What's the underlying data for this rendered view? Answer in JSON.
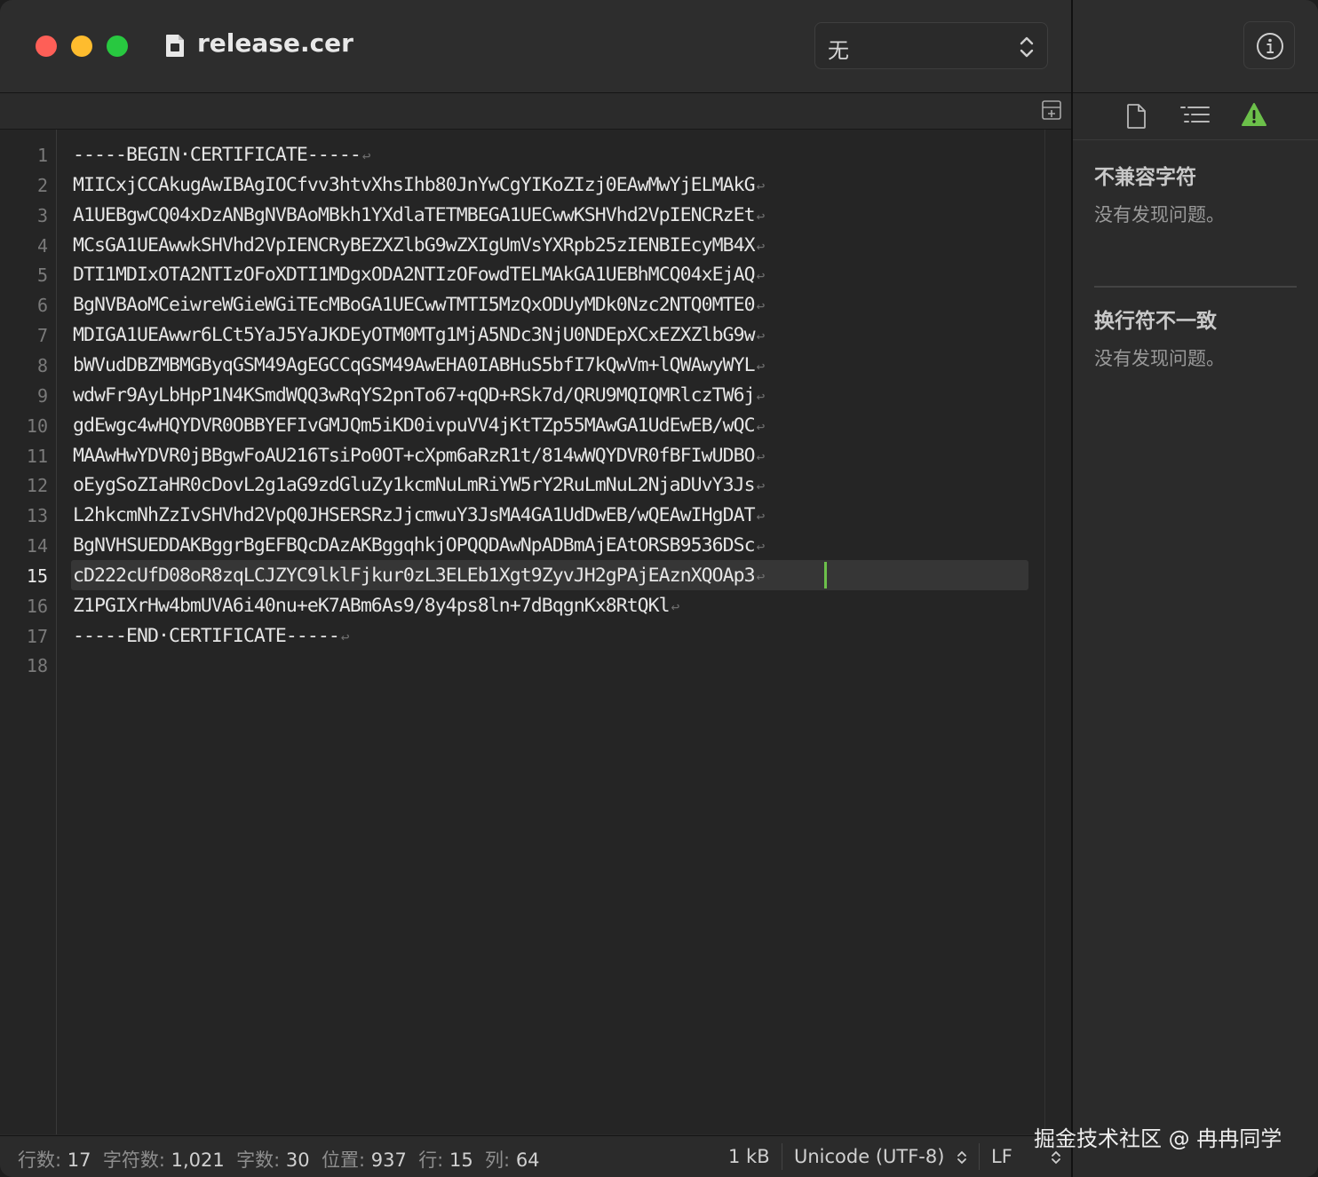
{
  "window": {
    "title": "release.cer",
    "syntax_selector": {
      "value": "无"
    }
  },
  "editor": {
    "current_line": 15,
    "lines": [
      {
        "num": "1",
        "text": "-----BEGIN·CERTIFICATE-----"
      },
      {
        "num": "2",
        "text": "MIICxjCCAkugAwIBAgIOCfvv3htvXhsIhb80JnYwCgYIKoZIzj0EAwMwYjELMAkG"
      },
      {
        "num": "3",
        "text": "A1UEBgwCQ04xDzANBgNVBAoMBkh1YXdlaTETMBEGA1UECwwKSHVhd2VpIENCRzEt"
      },
      {
        "num": "4",
        "text": "MCsGA1UEAwwkSHVhd2VpIENCRyBEZXZlbG9wZXIgUmVsYXRpb25zIENBIEcyMB4X"
      },
      {
        "num": "5",
        "text": "DTI1MDIxOTA2NTIzOFoXDTI1MDgxODA2NTIzOFowdTELMAkGA1UEBhMCQ04xEjAQ"
      },
      {
        "num": "6",
        "text": "BgNVBAoMCeiwreWGieWGiTEcMBoGA1UECwwTMTI5MzQxODUyMDk0Nzc2NTQ0MTE0"
      },
      {
        "num": "7",
        "text": "MDIGA1UEAwwr6LCt5YaJ5YaJKDEyOTM0MTg1MjA5NDc3NjU0NDEpXCxEZXZlbG9w"
      },
      {
        "num": "8",
        "text": "bWVudDBZMBMGByqGSM49AgEGCCqGSM49AwEHA0IABHuS5bfI7kQwVm+lQWAwyWYL"
      },
      {
        "num": "9",
        "text": "wdwFr9AyLbHpP1N4KSmdWQQ3wRqYS2pnTo67+qQD+RSk7d/QRU9MQIQMRlczTW6j"
      },
      {
        "num": "10",
        "text": "gdEwgc4wHQYDVR0OBBYEFIvGMJQm5iKD0ivpuVV4jKtTZp55MAwGA1UdEwEB/wQC"
      },
      {
        "num": "11",
        "text": "MAAwHwYDVR0jBBgwFoAU216TsiPo0OT+cXpm6aRzR1t/814wWQYDVR0fBFIwUDBO"
      },
      {
        "num": "12",
        "text": "oEygSoZIaHR0cDovL2g1aG9zdGluZy1kcmNuLmRiYW5rY2RuLmNuL2NjaDUvY3Js"
      },
      {
        "num": "13",
        "text": "L2hkcmNhZzIvSHVhd2VpQ0JHSERSRzJjcmwuY3JsMA4GA1UdDwEB/wQEAwIHgDAT"
      },
      {
        "num": "14",
        "text": "BgNVHSUEDDAKBggrBgEFBQcDAzAKBggqhkjOPQQDAwNpADBmAjEAtORSB9536DSc"
      },
      {
        "num": "15",
        "text": "cD222cUfD08oR8zqLCJZYC9lklFjkur0zL3ELEb1Xgt9ZyvJH2gPAjEAznXQOAp3"
      },
      {
        "num": "16",
        "text": "Z1PGIXrHw4bmUVA6i40nu+eK7ABm6As9/8y4ps8ln+7dBqgnKx8RtQKl"
      },
      {
        "num": "17",
        "text": "-----END·CERTIFICATE-----"
      },
      {
        "num": "18",
        "text": ""
      }
    ]
  },
  "statusbar": {
    "lines_label": "行数:",
    "lines_value": "17",
    "chars_label": "字符数:",
    "chars_value": "1,021",
    "words_label": "字数:",
    "words_value": "30",
    "pos_label": "位置:",
    "pos_value": "937",
    "row_label": "行:",
    "row_value": "15",
    "col_label": "列:",
    "col_value": "64",
    "file_size": "1 kB",
    "encoding": "Unicode (UTF-8)",
    "line_ending": "LF"
  },
  "inspector": {
    "section1_title": "不兼容字符",
    "section1_text": "没有发现问题。",
    "section2_title": "换行符不一致",
    "section2_text": "没有发现问题。",
    "warning_color": "#6cc04a"
  },
  "watermark": "掘金技术社区 @ 冉冉同学"
}
